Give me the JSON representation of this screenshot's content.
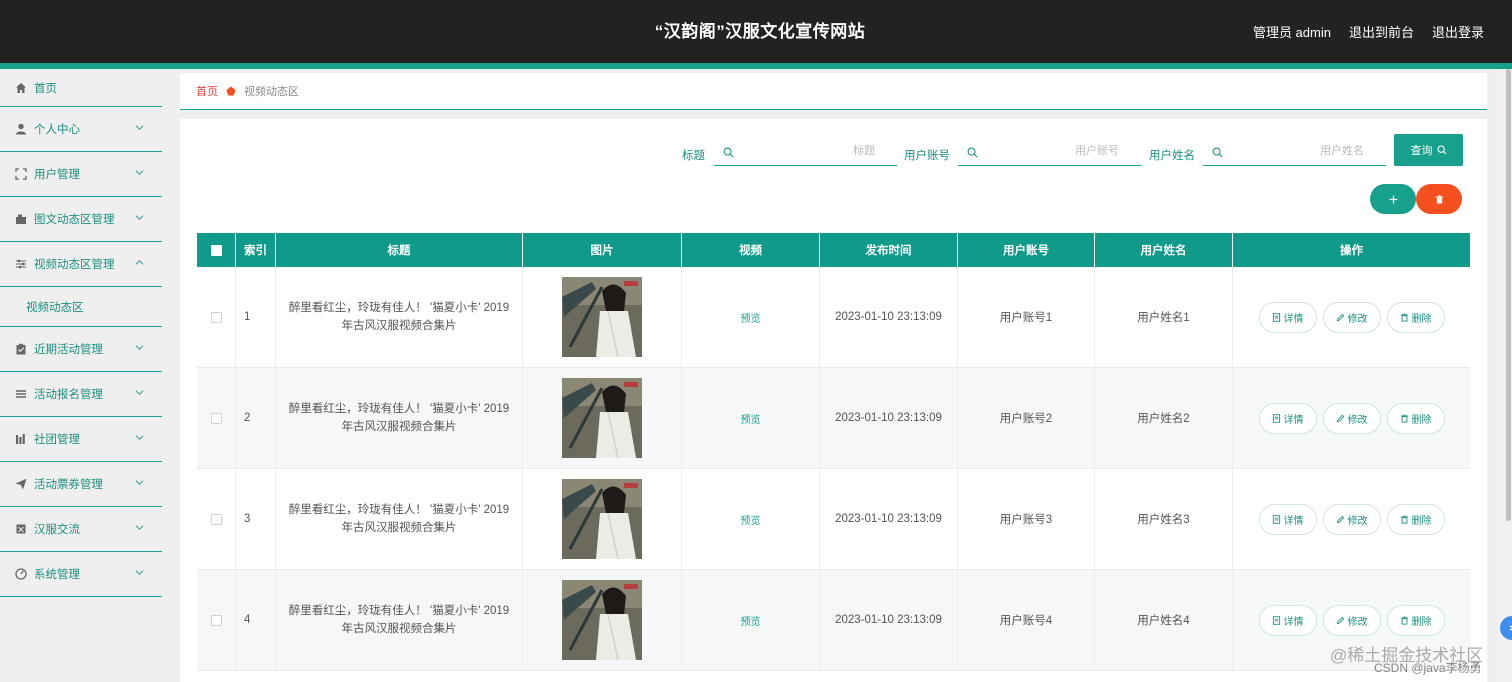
{
  "header": {
    "site_title": "“汉韵阁”汉服文化宣传网站",
    "admin_label": "管理员 admin",
    "to_front_label": "退出到前台",
    "logout_label": "退出登录"
  },
  "colors": {
    "accent": "#17a08c",
    "header_bg": "#222222",
    "delete": "#f4511e",
    "breadcrumb_home": "#e23c3c"
  },
  "sidebar": {
    "items": [
      {
        "label": "首页",
        "icon": "home-icon"
      },
      {
        "label": "个人中心",
        "icon": "user-icon"
      },
      {
        "label": "用户管理",
        "icon": "frame-icon"
      },
      {
        "label": "图文动态区管理",
        "icon": "image-text-icon"
      },
      {
        "label": "视频动态区管理",
        "icon": "sliders-icon",
        "expanded": true,
        "children": [
          "视频动态区"
        ]
      },
      {
        "label": "近期活动管理",
        "icon": "clipboard-icon"
      },
      {
        "label": "活动报名管理",
        "icon": "list-icon"
      },
      {
        "label": "社团管理",
        "icon": "bar-chart-icon"
      },
      {
        "label": "活动票券管理",
        "icon": "send-icon"
      },
      {
        "label": "汉服交流",
        "icon": "box-icon"
      },
      {
        "label": "系统管理",
        "icon": "gauge-icon"
      }
    ]
  },
  "breadcrumb": {
    "home": "首页",
    "current": "视频动态区"
  },
  "search": {
    "fields": [
      {
        "label": "标题",
        "placeholder": "标题",
        "value": ""
      },
      {
        "label": "用户账号",
        "placeholder": "用户账号",
        "value": ""
      },
      {
        "label": "用户姓名",
        "placeholder": "用户姓名",
        "value": ""
      }
    ],
    "query_label": "查询"
  },
  "actions": {
    "add_icon": "plus-icon",
    "delete_icon": "trash-icon"
  },
  "table": {
    "headers": [
      "索引",
      "标题",
      "图片",
      "视频",
      "发布时间",
      "用户账号",
      "用户姓名",
      "操作"
    ],
    "rows": [
      {
        "index": "1",
        "title": "醉里看红尘，玲珑有佳人！ '猫夏小卡' 2019年古风汉服视频合集片",
        "video": "预览",
        "time": "2023-01-10 23:13:09",
        "account": "用户账号1",
        "name": "用户姓名1"
      },
      {
        "index": "2",
        "title": "醉里看红尘，玲珑有佳人！ '猫夏小卡' 2019年古风汉服视频合集片",
        "video": "预览",
        "time": "2023-01-10 23:13:09",
        "account": "用户账号2",
        "name": "用户姓名2"
      },
      {
        "index": "3",
        "title": "醉里看红尘，玲珑有佳人！ '猫夏小卡' 2019年古风汉服视频合集片",
        "video": "预览",
        "time": "2023-01-10 23:13:09",
        "account": "用户账号3",
        "name": "用户姓名3"
      },
      {
        "index": "4",
        "title": "醉里看红尘，玲珑有佳人！ '猫夏小卡' 2019年古风汉服视频合集片",
        "video": "预览",
        "time": "2023-01-10 23:13:09",
        "account": "用户账号4",
        "name": "用户姓名4"
      }
    ],
    "op_labels": {
      "detail": "详情",
      "edit": "修改",
      "delete": "删除"
    }
  },
  "watermark": {
    "line1": "@稀土掘金技术社区",
    "line2": "CSDN @java李杨勇"
  }
}
